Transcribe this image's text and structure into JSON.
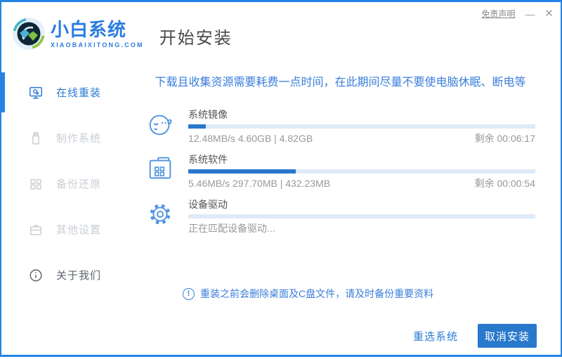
{
  "window": {
    "disclaimer_link": "免责声明",
    "minimize_glyph": "—",
    "close_glyph": "✕"
  },
  "header": {
    "brand_name": "小白系统",
    "brand_domain": "XIAOBAIXITONG.COM",
    "page_title": "开始安装"
  },
  "sidebar": {
    "items": [
      {
        "label": "在线重装",
        "icon": "monitor-online-icon",
        "state": "active"
      },
      {
        "label": "制作系统",
        "icon": "usb-drive-icon",
        "state": "disabled"
      },
      {
        "label": "备份还原",
        "icon": "backup-blocks-icon",
        "state": "disabled"
      },
      {
        "label": "其他设置",
        "icon": "briefcase-icon",
        "state": "disabled"
      },
      {
        "label": "关于我们",
        "icon": "info-circle-icon",
        "state": "normal"
      }
    ]
  },
  "main": {
    "warning_text": "下载且收集资源需要耗费一点时间，在此期间尽量不要使电脑休眠、断电等",
    "tasks": [
      {
        "name": "系统镜像",
        "icon": "face-mascot-icon",
        "detail": "12.48MB/s 4.60GB | 4.82GB",
        "remaining": "剩余 00:06:17",
        "progress_percent": 5
      },
      {
        "name": "系统软件",
        "icon": "folder-apps-icon",
        "detail": "5.46MB/s 297.70MB | 432.23MB",
        "remaining": "剩余 00:00:54",
        "progress_percent": 31
      },
      {
        "name": "设备驱动",
        "icon": "gear-icon",
        "detail": "正在匹配设备驱动...",
        "remaining": "",
        "progress_percent": 0
      }
    ],
    "notice_exclamation": "!",
    "notice_text": "重装之前会删除桌面及C盘文件，请及时备份重要资料"
  },
  "footer": {
    "reselect_button": "重选系统",
    "cancel_button": "取消安装"
  },
  "colors": {
    "accent_blue": "#2583e6",
    "brand_blue": "#2a7ce0",
    "text_blue": "#3a7edb",
    "progress_fill": "#2b76cc",
    "progress_track": "#dfeaf7"
  }
}
